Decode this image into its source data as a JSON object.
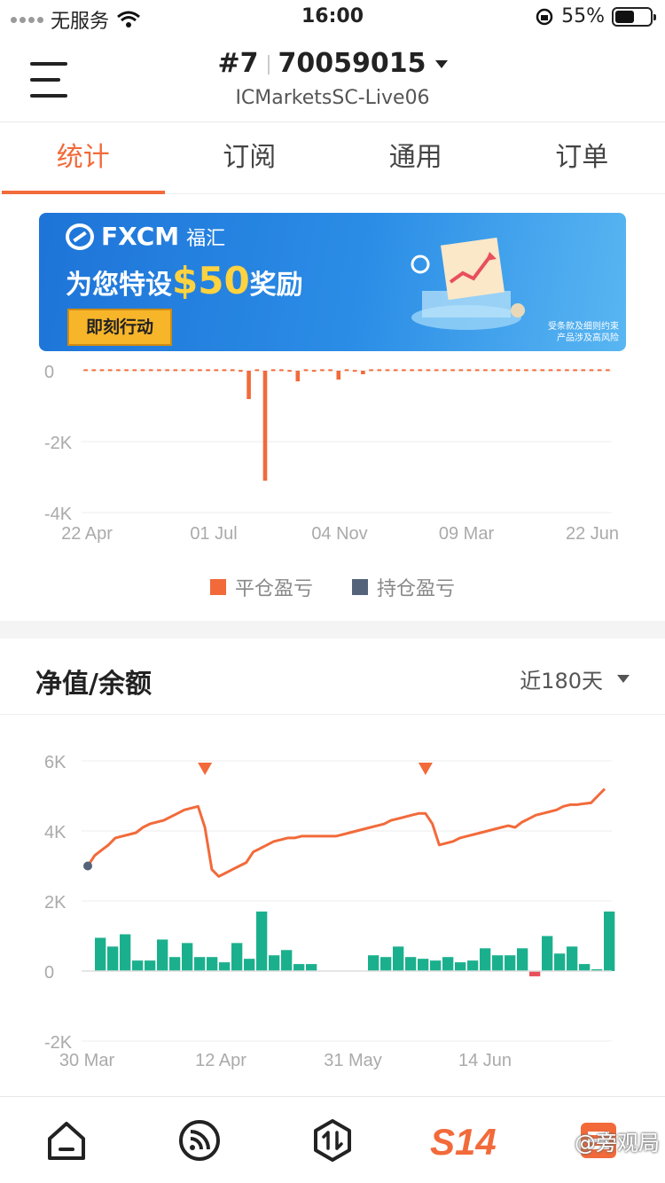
{
  "status_bar": {
    "carrier": "无服务",
    "time": "16:00",
    "battery": "55%",
    "battery_level": 0.55
  },
  "header": {
    "account_prefix": "#7",
    "account_number": "70059015",
    "server": "ICMarketsSC-Live06"
  },
  "tabs": [
    {
      "label": "统计",
      "active": true
    },
    {
      "label": "订阅",
      "active": false
    },
    {
      "label": "通用",
      "active": false
    },
    {
      "label": "订单",
      "active": false
    }
  ],
  "banner": {
    "brand": "FXCM",
    "brand_sub": "福汇",
    "headline_pre": "为您特设",
    "headline_amount": "$50",
    "headline_post": "奖励",
    "cta": "即刻行动",
    "fine_print_1": "受条款及细则约束",
    "fine_print_2": "产品涉及高风险"
  },
  "chart_data": [
    {
      "type": "bar",
      "x_ticks": [
        "22 Apr",
        "01 Jul",
        "04 Nov",
        "09 Mar",
        "22 Jun"
      ],
      "y_ticks": [
        "0",
        "-2K",
        "-4K"
      ],
      "ylim": [
        -4000,
        0
      ],
      "series": [
        {
          "name": "平仓盈亏",
          "color": "#f26a3a",
          "values": [
            40,
            40,
            40,
            40,
            40,
            40,
            40,
            40,
            40,
            40,
            40,
            40,
            40,
            40,
            40,
            40,
            40,
            40,
            40,
            20,
            -800,
            40,
            -3100,
            40,
            40,
            20,
            -300,
            40,
            20,
            40,
            40,
            -250,
            40,
            20,
            -100,
            40,
            40,
            40,
            40,
            40,
            40,
            40,
            40,
            40,
            40,
            40,
            40,
            40,
            40,
            40,
            40,
            40,
            40,
            40,
            40,
            40,
            40,
            40,
            40,
            40,
            40,
            40,
            40,
            40,
            40
          ]
        },
        {
          "name": "持仓盈亏",
          "color": "#55637a",
          "values": []
        }
      ]
    },
    {
      "type": "line+bar",
      "x_ticks": [
        "30 Mar",
        "12 Apr",
        "31 May",
        "14 Jun"
      ],
      "y_ticks": [
        "6K",
        "4K",
        "2K",
        "0",
        "-2K"
      ],
      "ylim": [
        -2000,
        6000
      ],
      "line_color": "#f26a3a",
      "line_values": [
        3000,
        3300,
        3450,
        3600,
        3800,
        3850,
        3900,
        3950,
        4100,
        4200,
        4250,
        4300,
        4400,
        4500,
        4600,
        4650,
        4700,
        4100,
        2900,
        2700,
        2800,
        2900,
        3000,
        3100,
        3400,
        3500,
        3600,
        3700,
        3750,
        3800,
        3800,
        3850,
        3850,
        3850,
        3850,
        3850,
        3850,
        3900,
        3950,
        4000,
        4050,
        4100,
        4150,
        4200,
        4300,
        4350,
        4400,
        4450,
        4500,
        4500,
        4200,
        3600,
        3650,
        3700,
        3800,
        3850,
        3900,
        3950,
        4000,
        4050,
        4100,
        4150,
        4100,
        4250,
        4350,
        4450,
        4500,
        4550,
        4600,
        4700,
        4750,
        4750,
        4780,
        4800,
        5000,
        5200
      ],
      "markers": [
        {
          "x_index": 17,
          "label": "▼"
        },
        {
          "x_index": 49,
          "label": "▼"
        }
      ],
      "bar_values": [
        950,
        700,
        1050,
        300,
        300,
        900,
        400,
        800,
        400,
        400,
        250,
        800,
        350,
        1700,
        450,
        600,
        200,
        200,
        0,
        0,
        0,
        0,
        450,
        400,
        700,
        400,
        350,
        300,
        400,
        250,
        300,
        650,
        450,
        450,
        650,
        -150,
        1000,
        500,
        700,
        200,
        50,
        1700
      ],
      "bar_color_pos": "#1bb08d",
      "bar_color_neg": "#e8505b"
    }
  ],
  "legend": [
    {
      "label": "平仓盈亏",
      "color": "#f26a3a"
    },
    {
      "label": "持仓盈亏",
      "color": "#55637a"
    }
  ],
  "equity": {
    "title": "净值/余额",
    "range": "近180天"
  },
  "bottom_nav": [
    {
      "name": "home",
      "label": "home-icon"
    },
    {
      "name": "signals",
      "label": "rss-icon"
    },
    {
      "name": "trade",
      "label": "trade-arrows-icon"
    },
    {
      "name": "s14",
      "label": "S14"
    },
    {
      "name": "more",
      "label": "more-icon"
    }
  ],
  "watermark": "@旁观局"
}
